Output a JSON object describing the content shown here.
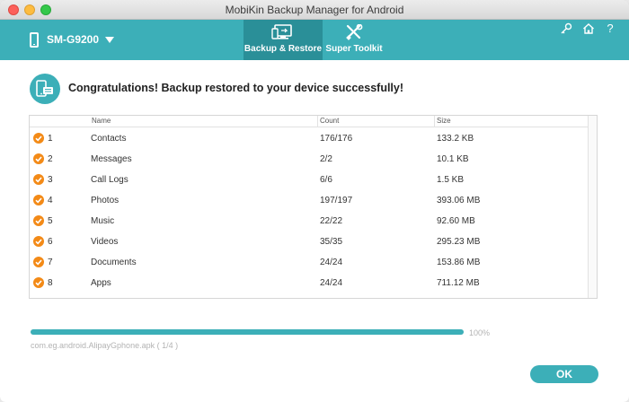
{
  "window": {
    "title": "MobiKin Backup Manager for Android"
  },
  "header": {
    "device_name": "SM-G9200",
    "tabs": [
      {
        "label": "Backup & Restore",
        "icon": "backup-restore-icon",
        "active": true
      },
      {
        "label": "Super Toolkit",
        "icon": "tools-icon",
        "active": false
      }
    ],
    "actions": [
      {
        "icon": "key-icon"
      },
      {
        "icon": "home-icon"
      },
      {
        "icon": "help-icon",
        "glyph": "?"
      }
    ]
  },
  "result": {
    "message": "Congratulations! Backup restored to your device successfully!",
    "icon": "phone-restore-icon"
  },
  "table": {
    "columns": {
      "name": "Name",
      "count": "Count",
      "size": "Size"
    },
    "rows": [
      {
        "index": "1",
        "name": "Contacts",
        "count": "176/176",
        "size": "133.2 KB"
      },
      {
        "index": "2",
        "name": "Messages",
        "count": "2/2",
        "size": "10.1 KB"
      },
      {
        "index": "3",
        "name": "Call Logs",
        "count": "6/6",
        "size": "1.5 KB"
      },
      {
        "index": "4",
        "name": "Photos",
        "count": "197/197",
        "size": "393.06 MB"
      },
      {
        "index": "5",
        "name": "Music",
        "count": "22/22",
        "size": "92.60 MB"
      },
      {
        "index": "6",
        "name": "Videos",
        "count": "35/35",
        "size": "295.23 MB"
      },
      {
        "index": "7",
        "name": "Documents",
        "count": "24/24",
        "size": "153.86 MB"
      },
      {
        "index": "8",
        "name": "Apps",
        "count": "24/24",
        "size": "711.12 MB"
      }
    ]
  },
  "progress": {
    "percent_label": "100%",
    "fraction": 1.0,
    "current_file": "com.eg.android.AlipayGphone.apk ( 1/4 )"
  },
  "footer": {
    "ok_label": "OK"
  },
  "colors": {
    "accent": "#3cafb8",
    "accent_dark": "#2a8f98",
    "check": "#f38a17"
  }
}
